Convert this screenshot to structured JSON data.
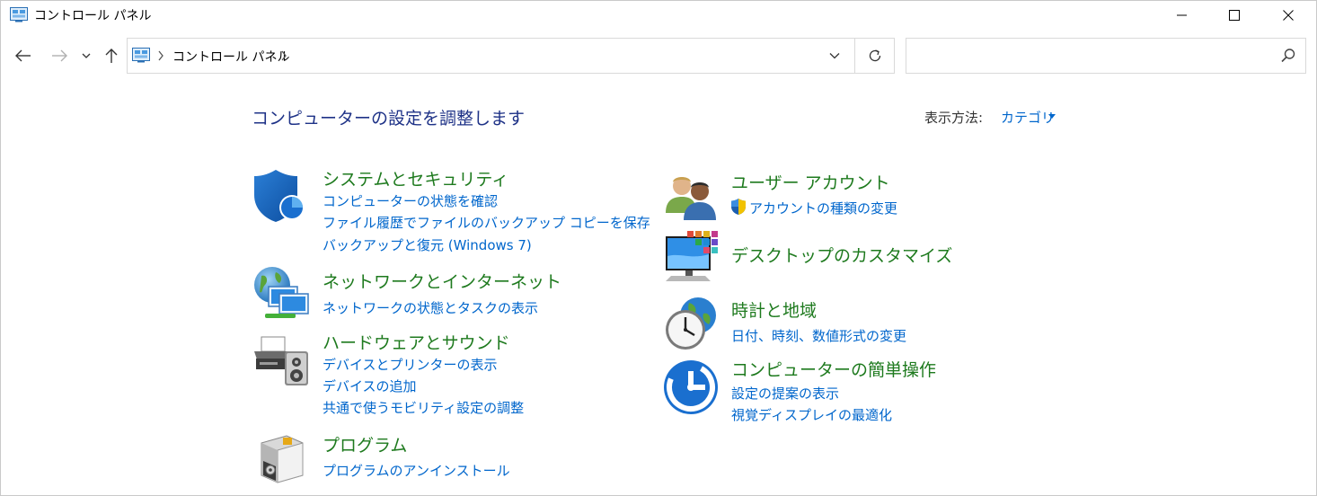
{
  "window": {
    "title": "コントロール パネル",
    "minimize_icon": "minimize-icon",
    "maximize_icon": "maximize-icon",
    "close_icon": "close-icon"
  },
  "nav": {
    "back_icon": "arrow-left-icon",
    "forward_icon": "arrow-right-icon",
    "recent_icon": "chevron-down-icon",
    "up_icon": "arrow-up-icon"
  },
  "address": {
    "segments": [
      "コントロール パネル"
    ],
    "refresh_icon": "refresh-icon",
    "dropdown_icon": "chevron-down-icon"
  },
  "search": {
    "placeholder": "",
    "value": ""
  },
  "content": {
    "heading": "コンピューターの設定を調整します",
    "view_by_label": "表示方法:",
    "view_by_value": "カテゴリ"
  },
  "categories": [
    {
      "title": "システムとセキュリティ",
      "icon": "shield-icon",
      "links": [
        "コンピューターの状態を確認",
        "ファイル履歴でファイルのバックアップ コピーを保存",
        "バックアップと復元 (Windows 7)"
      ]
    },
    {
      "title": "ネットワークとインターネット",
      "icon": "network-icon",
      "links": [
        "ネットワークの状態とタスクの表示"
      ]
    },
    {
      "title": "ハードウェアとサウンド",
      "icon": "printer-icon",
      "links": [
        "デバイスとプリンターの表示",
        "デバイスの追加",
        "共通で使うモビリティ設定の調整"
      ]
    },
    {
      "title": "プログラム",
      "icon": "programs-icon",
      "links": [
        "プログラムのアンインストール"
      ]
    },
    {
      "title": "ユーザー アカウント",
      "icon": "users-icon",
      "links": [
        "アカウントの種類の変更"
      ]
    },
    {
      "title": "デスクトップのカスタマイズ",
      "icon": "desktop-icon",
      "links": []
    },
    {
      "title": "時計と地域",
      "icon": "clock-globe-icon",
      "links": [
        "日付、時刻、数値形式の変更"
      ]
    },
    {
      "title": "コンピューターの簡単操作",
      "icon": "ease-of-access-icon",
      "links": [
        "設定の提案の表示",
        "視覚ディスプレイの最適化"
      ]
    }
  ],
  "colors": {
    "heading": "#1e3287",
    "category_title": "#1e7a1e",
    "link": "#0066cc"
  }
}
